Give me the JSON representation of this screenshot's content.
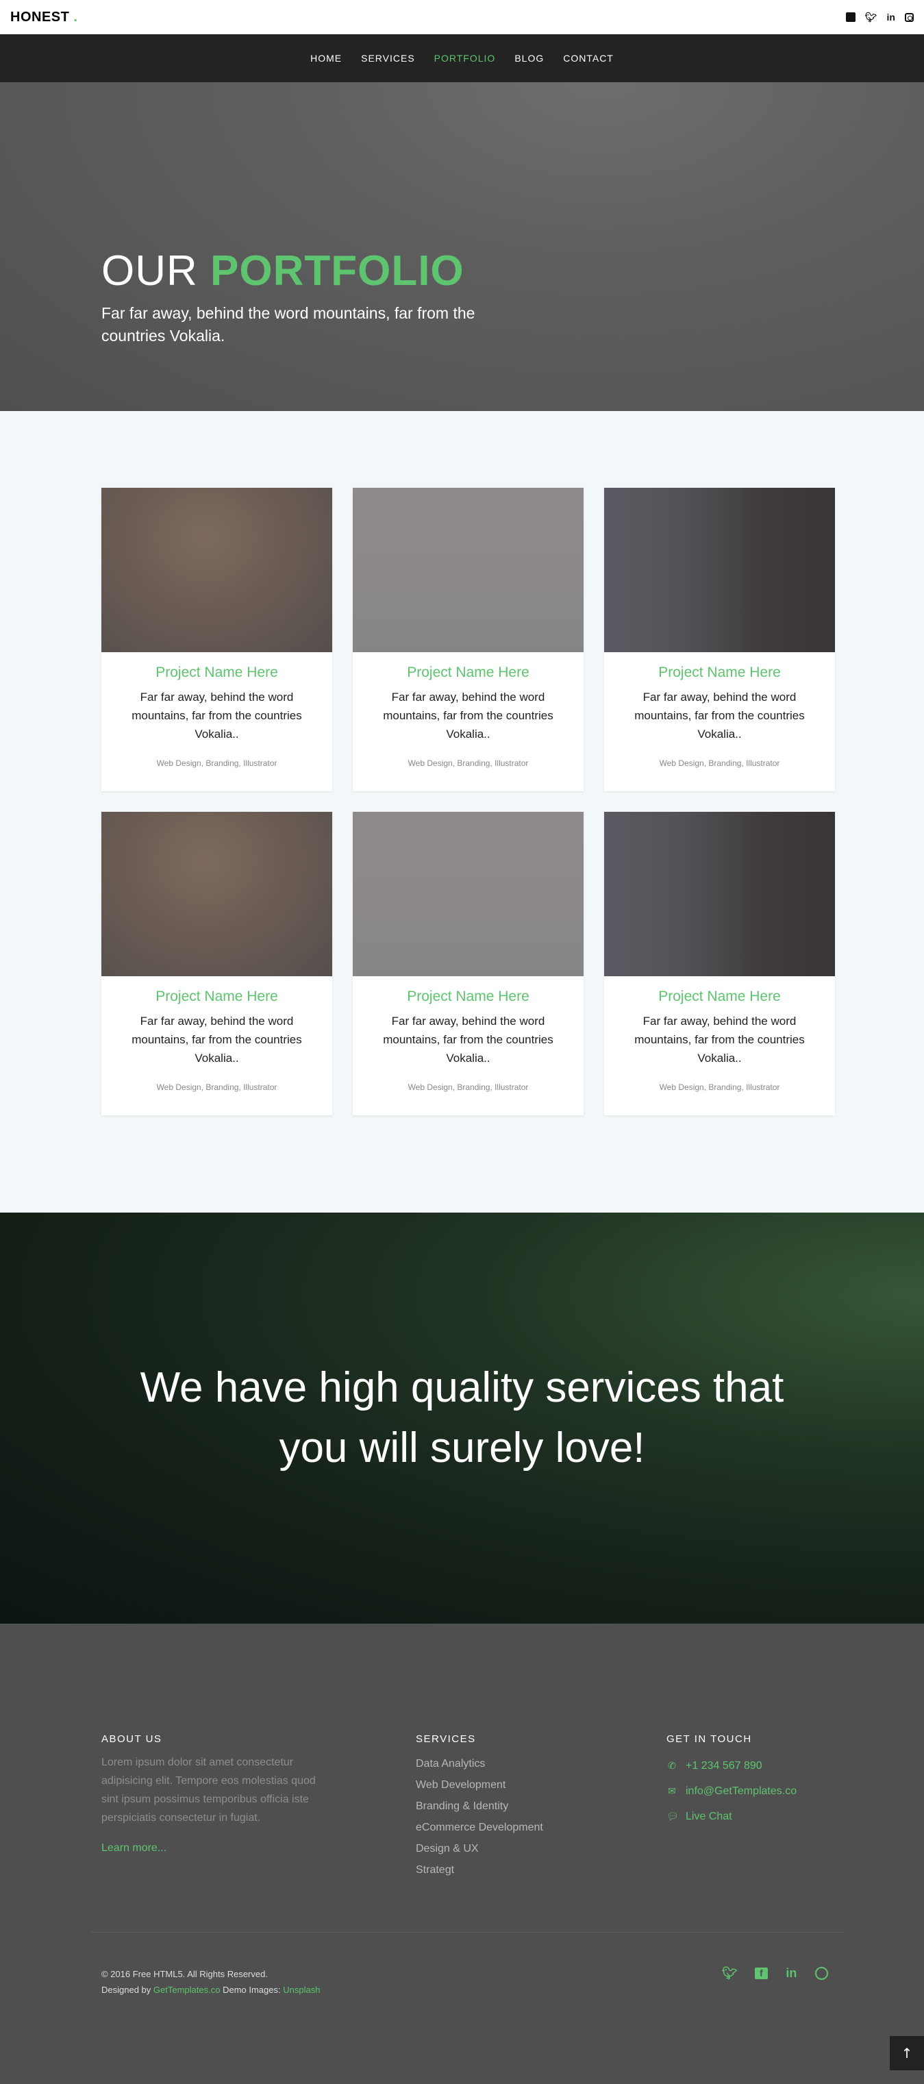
{
  "brand": {
    "name": "HONEST",
    "dot": "."
  },
  "top_social": [
    "facebook-icon",
    "twitter-icon",
    "linkedin-icon",
    "instagram-icon"
  ],
  "nav": {
    "items": [
      {
        "label": "HOME"
      },
      {
        "label": "SERVICES"
      },
      {
        "label": "PORTFOLIO",
        "active": true
      },
      {
        "label": "BLOG"
      },
      {
        "label": "CONTACT"
      }
    ]
  },
  "hero": {
    "title_light": "OUR",
    "title_bold": "PORTFOLIO",
    "subtitle": "Far far away, behind the word mountains, far from the countries Vokalia."
  },
  "projects": [
    {
      "name": "Project Name Here",
      "desc": "Far far away, behind the word mountains, far from the countries Vokalia..",
      "tags": "Web Design, Branding, Illustrator"
    },
    {
      "name": "Project Name Here",
      "desc": "Far far away, behind the word mountains, far from the countries Vokalia..",
      "tags": "Web Design, Branding, Illustrator"
    },
    {
      "name": "Project Name Here",
      "desc": "Far far away, behind the word mountains, far from the countries Vokalia..",
      "tags": "Web Design, Branding, Illustrator"
    },
    {
      "name": "Project Name Here",
      "desc": "Far far away, behind the word mountains, far from the countries Vokalia..",
      "tags": "Web Design, Branding, Illustrator"
    },
    {
      "name": "Project Name Here",
      "desc": "Far far away, behind the word mountains, far from the countries Vokalia..",
      "tags": "Web Design, Branding, Illustrator"
    },
    {
      "name": "Project Name Here",
      "desc": "Far far away, behind the word mountains, far from the countries Vokalia..",
      "tags": "Web Design, Branding, Illustrator"
    }
  ],
  "band": {
    "text": "We have high quality services that you will surely love!"
  },
  "footer": {
    "about": {
      "heading": "ABOUT US",
      "text": "Lorem ipsum dolor sit amet consectetur adipisicing elit. Tempore eos molestias quod sint ipsum possimus temporibus officia iste perspiciatis consectetur in fugiat.",
      "link": "Learn more..."
    },
    "services": {
      "heading": "SERVICES",
      "items": [
        "Data Analytics",
        "Web Development",
        "Branding & Identity",
        "eCommerce Development",
        "Design & UX",
        "Strategt"
      ]
    },
    "contact": {
      "heading": "GET IN TOUCH",
      "phone": "+1 234 567 890",
      "email": "info@GetTemplates.co",
      "chat": "Live Chat"
    },
    "copyright": "© 2016 Free HTML5. All Rights Reserved.",
    "designed_prefix": "Designed by",
    "designed_by": "GetTemplates.co",
    "demo_prefix": "Demo Images:",
    "demo_images": "Unsplash",
    "social": [
      "twitter-icon",
      "facebook-icon",
      "linkedin-icon",
      "dribbble-icon"
    ]
  },
  "colors": {
    "accent": "#5fc46f",
    "nav_bg": "#232323",
    "footer_bg": "#4f4f4f"
  }
}
